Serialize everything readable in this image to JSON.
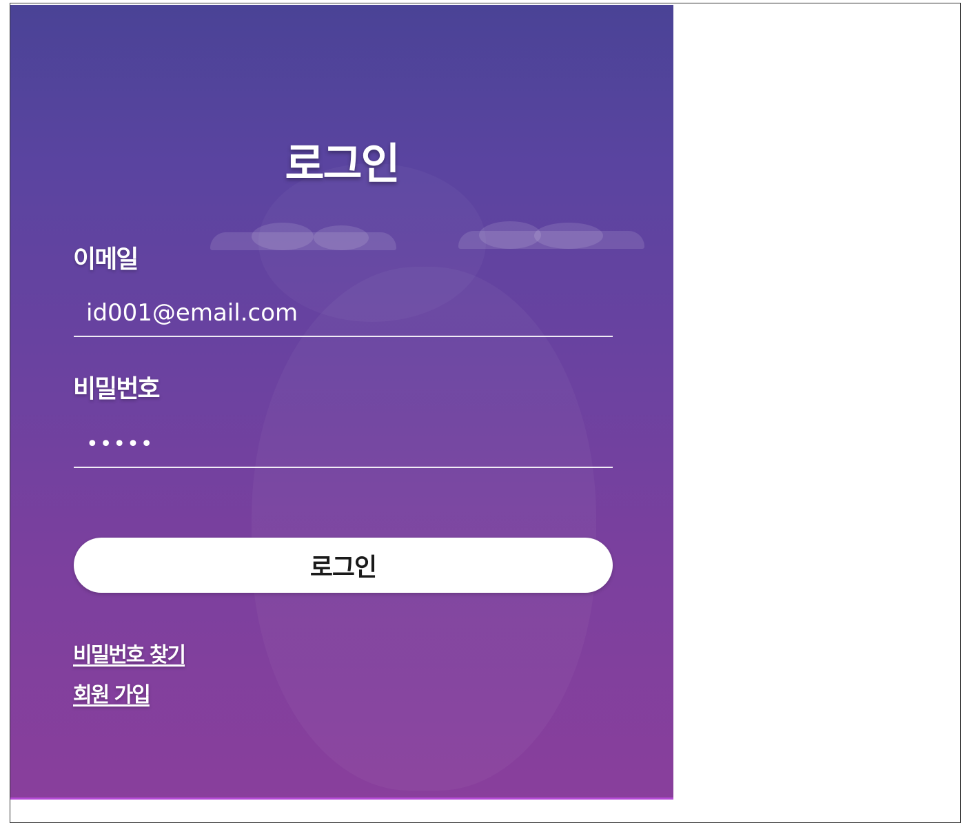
{
  "login_form": {
    "title": "로그인",
    "email": {
      "label": "이메일",
      "value": "id001@email.com"
    },
    "password": {
      "label": "비밀번호",
      "value": "•••••"
    },
    "submit_label": "로그인",
    "links": {
      "find_password": "비밀번호 찾기",
      "signup": "회원 가입"
    }
  },
  "colors": {
    "panel_top": "#4a4396",
    "panel_bottom": "#893f9c",
    "accent_border": "#b54bd6",
    "button_bg": "#ffffff",
    "text": "#ffffff"
  }
}
